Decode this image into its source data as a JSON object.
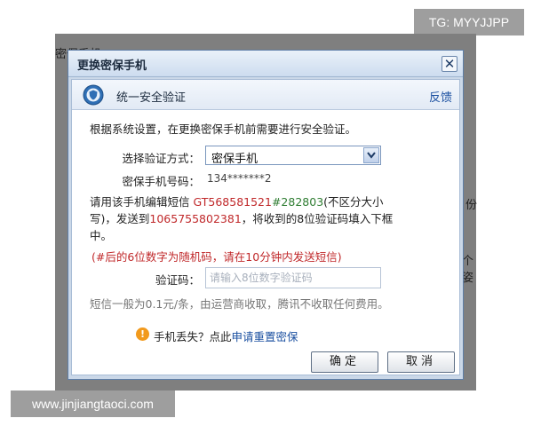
{
  "watermark": {
    "top": "TG: MYYJJPP",
    "bottom": "www.jinjiangtaoci.com"
  },
  "background": {
    "frag_left": "密保手机",
    "frag_right1": "份",
    "frag_right2": "个姿"
  },
  "dialog": {
    "title": "更换密保手机",
    "close_label": "✕",
    "section_title": "统一安全验证",
    "feedback_label": "反馈",
    "intro": "根据系统设置，在更换密保手机前需要进行安全验证。",
    "method_label": "选择验证方式：",
    "method_value": "密保手机",
    "phone_label": "密保手机号码：",
    "phone_value": "134*******2",
    "sms_line1_a": "请用该手机编辑短信",
    "sms_code": "GT568581521",
    "sms_hash": "#282803",
    "sms_line1_b": "(不区分大小",
    "sms_line2_a": "写)，发送到",
    "sms_number": "1065755802381",
    "sms_line2_b": "，将收到的8位验证码填入下框",
    "sms_line3": "中。",
    "warning": "(#后的6位数字为随机码，请在10分钟内发送短信)",
    "code_label": "验证码：",
    "code_placeholder": "请输入8位数字验证码",
    "fee_note": "短信一般为0.1元/条，由运营商收取，腾讯不收取任何费用。",
    "lost_prefix": "手机丢失？点此",
    "lost_link": "申请重置密保",
    "ok_label": "确定",
    "cancel_label": "取消"
  },
  "colors": {
    "backdrop": "#7f7f7f",
    "dialog_border": "#5f7fa8",
    "link": "#1a4fa0",
    "warning": "#c0282a"
  }
}
